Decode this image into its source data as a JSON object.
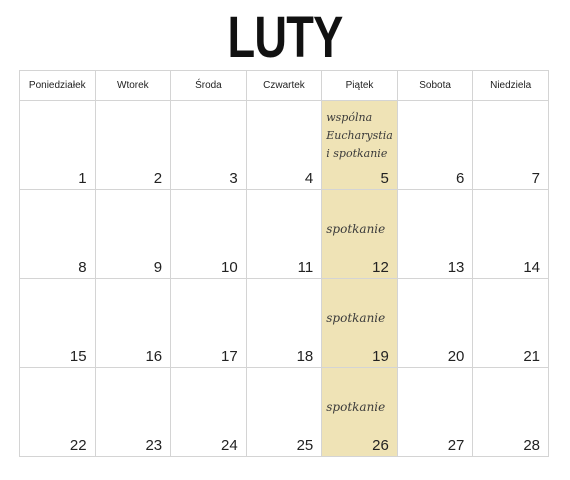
{
  "title": "LUTY",
  "weekdays": [
    "Poniedziałek",
    "Wtorek",
    "Środa",
    "Czwartek",
    "Piątek",
    "Sobota",
    "Niedziela"
  ],
  "weeks": [
    {
      "days": [
        "1",
        "2",
        "3",
        "4",
        "5",
        "6",
        "7"
      ]
    },
    {
      "days": [
        "8",
        "9",
        "10",
        "11",
        "12",
        "13",
        "14"
      ]
    },
    {
      "days": [
        "15",
        "16",
        "17",
        "18",
        "19",
        "20",
        "21"
      ]
    },
    {
      "days": [
        "22",
        "23",
        "24",
        "25",
        "26",
        "27",
        "28"
      ]
    }
  ],
  "highlight_color": "#efe3b6",
  "notes": {
    "w1": [
      "wspólna",
      "Eucharystia",
      "i spotkanie"
    ],
    "w2": "spotkanie",
    "w3": "spotkanie",
    "w4": "spotkanie"
  }
}
